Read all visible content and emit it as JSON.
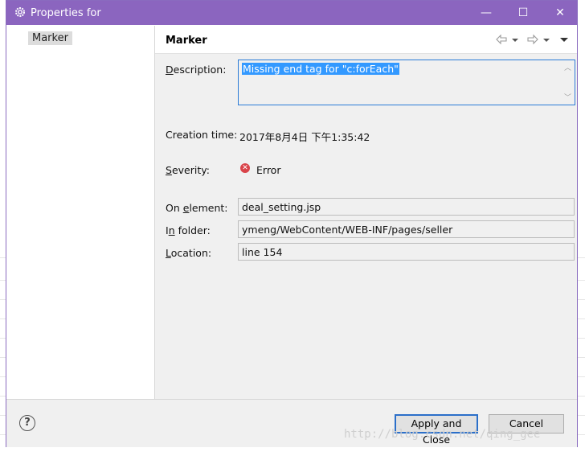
{
  "window": {
    "title": "Properties for",
    "minimize_glyph": "—",
    "maximize_glyph": "☐",
    "close_glyph": "✕"
  },
  "tree": {
    "items": [
      {
        "label": "Marker",
        "selected": true
      }
    ]
  },
  "page": {
    "title": "Marker",
    "nav": {
      "back_icon": "arrow-left-icon",
      "forward_icon": "arrow-right-icon",
      "menu_icon": "menu-down-icon"
    }
  },
  "properties": {
    "description": {
      "label_prefix": "",
      "label_u": "D",
      "label_rest": "escription:",
      "value": "Missing end tag for \"c:forEach\""
    },
    "creation_time": {
      "label": "Creation time:",
      "value": "2017年8月4日 下午1:35:42"
    },
    "severity": {
      "label_u": "S",
      "label_rest": "everity:",
      "value": "Error",
      "icon": "error-icon"
    },
    "on_element": {
      "label_prefix": "On ",
      "label_u": "e",
      "label_rest": "lement:",
      "value": "deal_setting.jsp"
    },
    "in_folder": {
      "label_prefix": "I",
      "label_u": "n",
      "label_rest": " folder:",
      "value": "ymeng/WebContent/WEB-INF/pages/seller"
    },
    "location": {
      "label_u": "L",
      "label_rest": "ocation:",
      "value": "line 154"
    }
  },
  "footer": {
    "help_icon": "help-icon",
    "help_glyph": "?",
    "apply_close_label": "Apply and Close",
    "cancel_label": "Cancel"
  },
  "watermark": "http://blog.csdn.net/qing_gee",
  "colors": {
    "titlebar": "#8b65bf",
    "selection": "#3399ff",
    "focus_border": "#2b6fc9",
    "error": "#d9444a"
  }
}
